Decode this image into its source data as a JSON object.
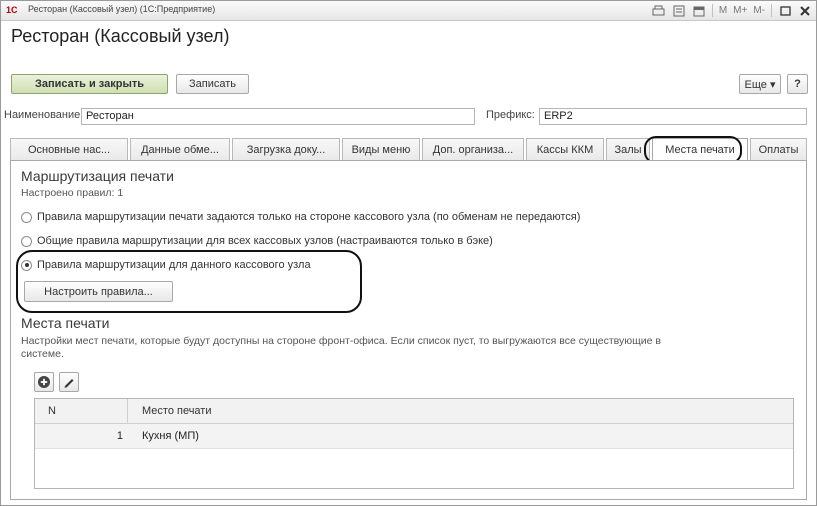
{
  "titlebar": {
    "logo": "1С",
    "title": "Ресторан (Кассовый узел)  (1С:Предприятие)",
    "m_buttons": [
      "M",
      "M+",
      "M-"
    ]
  },
  "form": {
    "title": "Ресторан (Кассовый узел)",
    "save_close_label": "Записать и закрыть",
    "save_label": "Записать",
    "more_label": "Еще ▾",
    "help_label": "?"
  },
  "fields": {
    "name_label": "Наименование:",
    "name_value": "Ресторан",
    "prefix_label": "Префикс:",
    "prefix_value": "ERP2"
  },
  "tabs": [
    {
      "label": "Основные нас..."
    },
    {
      "label": "Данные обме..."
    },
    {
      "label": "Загрузка доку..."
    },
    {
      "label": "Виды меню"
    },
    {
      "label": "Доп. организа..."
    },
    {
      "label": "Кассы ККМ"
    },
    {
      "label": "Залы"
    },
    {
      "label": "Места печати"
    },
    {
      "label": "Оплаты"
    }
  ],
  "active_tab": "Места печати",
  "routing": {
    "title": "Маршрутизация печати",
    "rules_count": "Настроено правил: 1",
    "options": [
      {
        "label": "Правила маршрутизации печати задаются только на стороне кассового узла (по обменам не передаются)",
        "selected": false
      },
      {
        "label": "Общие правила маршрутизации для всех кассовых узлов (настраиваются только в бэке)",
        "selected": false
      },
      {
        "label": "Правила маршрутизации для данного кассового узла",
        "selected": true
      }
    ],
    "configure_button": "Настроить правила..."
  },
  "print_places": {
    "title": "Места печати",
    "description_line1": "Настройки мест печати, которые будут доступны на стороне фронт-офиса. Если список пуст, то выгружаются все существующие в",
    "description_line2": "системе.",
    "columns": [
      "N",
      "Место печати"
    ],
    "rows": [
      {
        "n": "1",
        "place": "Кухня (МП)"
      }
    ]
  },
  "colors": {
    "primary_button": "#cfdfb2",
    "highlight_oval": "#111111"
  }
}
